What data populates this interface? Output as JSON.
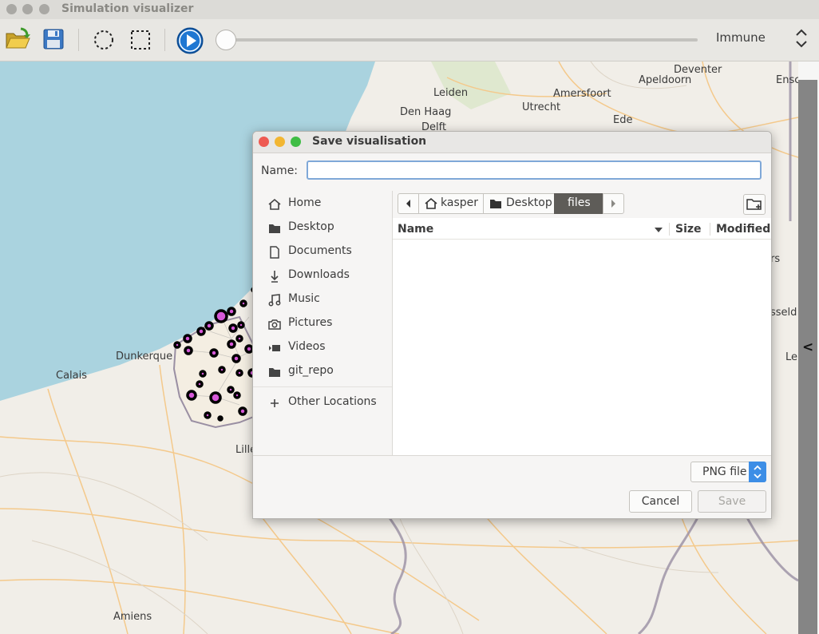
{
  "app": {
    "title": "Simulation visualizer"
  },
  "toolbar": {
    "mode_value": "Immune",
    "playback_progress": 0.0
  },
  "map": {
    "cities": [
      "Deventer",
      "Apeldoorn",
      "Ensc",
      "Leiden",
      "Amersfoort",
      "Den Haag",
      "Utrecht",
      "Delft",
      "Ede",
      "Dunkerque",
      "Calais",
      "Lille",
      "Amiens",
      "rs",
      "sseld",
      "Le"
    ]
  },
  "dialog": {
    "title": "Save visualisation",
    "name_label": "Name:",
    "name_value": "",
    "sidebar": [
      "Home",
      "Desktop",
      "Documents",
      "Downloads",
      "Music",
      "Pictures",
      "Videos",
      "git_repo",
      "Other Locations"
    ],
    "path": [
      "kasper",
      "Desktop",
      "files"
    ],
    "columns": {
      "name": "Name",
      "size": "Size",
      "modified": "Modified"
    },
    "filter": "PNG file",
    "cancel": "Cancel",
    "save": "Save"
  },
  "colors": {
    "accent": "#3d8ee6",
    "node_fill": "#d658d8",
    "sea": "#aad3df",
    "active_path": "#5e5c58"
  }
}
